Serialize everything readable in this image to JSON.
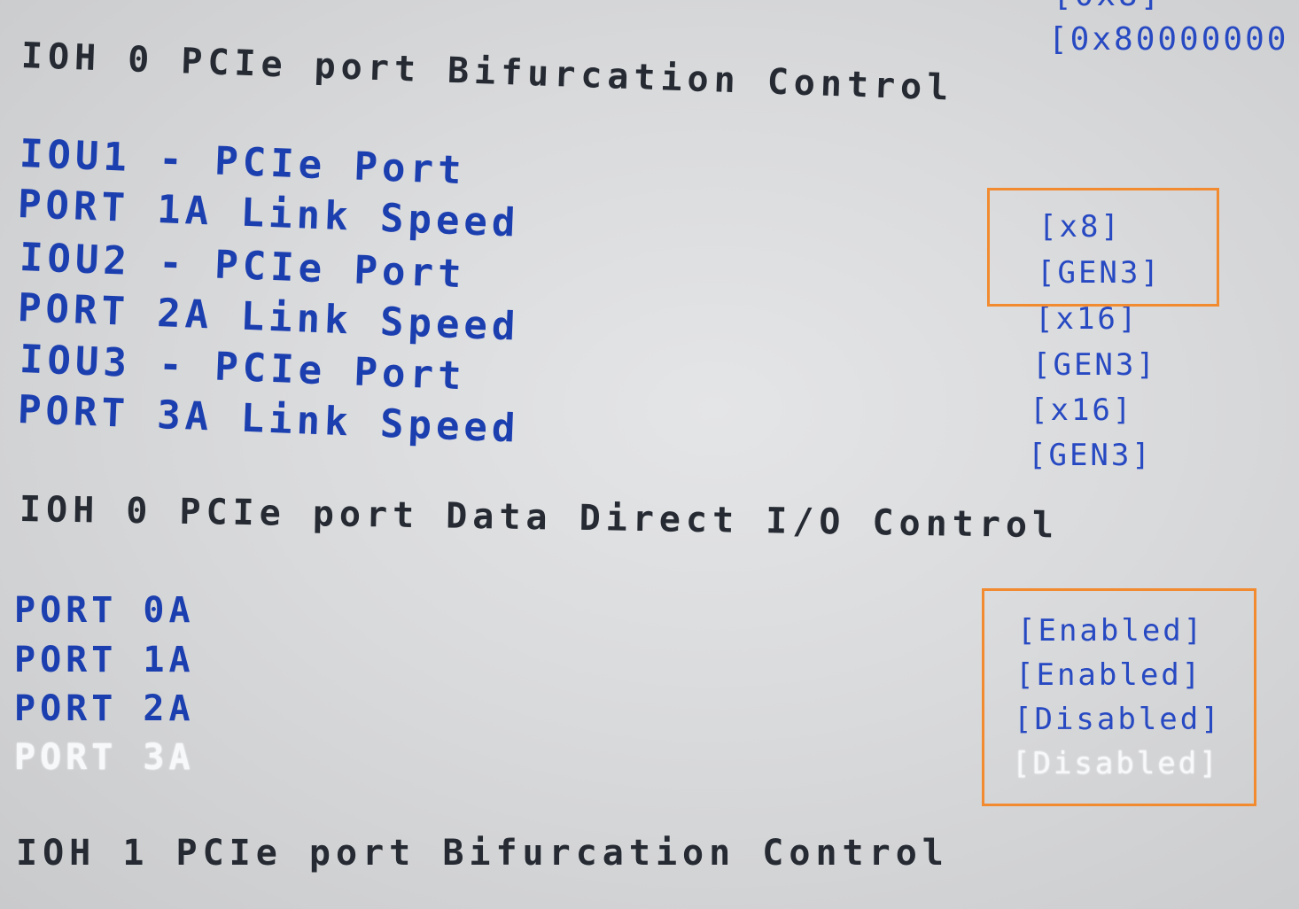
{
  "top_right_partial": {
    "value_partial_1": "[0x8]",
    "value_partial_2": "[0x80000000"
  },
  "section_1": {
    "title": "IOH 0 PCIe port Bifurcation Control"
  },
  "bifurcation_items": [
    {
      "label": "IOU1 - PCIe Port",
      "value": "[x8]"
    },
    {
      "label": "PORT 1A Link Speed",
      "value": "[GEN3]"
    },
    {
      "label": "IOU2 - PCIe Port",
      "value": "[x16]"
    },
    {
      "label": "PORT 2A Link Speed",
      "value": "[GEN3]"
    },
    {
      "label": "IOU3 - PCIe Port",
      "value": "[x16]"
    },
    {
      "label": "PORT 3A Link Speed",
      "value": ""
    },
    {
      "label": "",
      "value": "[GEN3]"
    }
  ],
  "section_2": {
    "title": "IOH 0 PCIe port Data Direct I/O Control"
  },
  "ddio_items": [
    {
      "label": "PORT 0A",
      "value": "[Enabled]"
    },
    {
      "label": "PORT 1A",
      "value": "[Enabled]"
    },
    {
      "label": "PORT 2A",
      "value": "[Disabled]"
    },
    {
      "label": "PORT 3A",
      "value": "[Disabled]",
      "selected": true
    }
  ],
  "section_3": {
    "title": "IOH 1 PCIe port Bifurcation Control"
  },
  "colors": {
    "background": "#dcdddf",
    "section_text": "#262b33",
    "item_text": "#1c3fb0",
    "selected_text": "#f7f8fa",
    "highlight_box": "#f28a30"
  }
}
